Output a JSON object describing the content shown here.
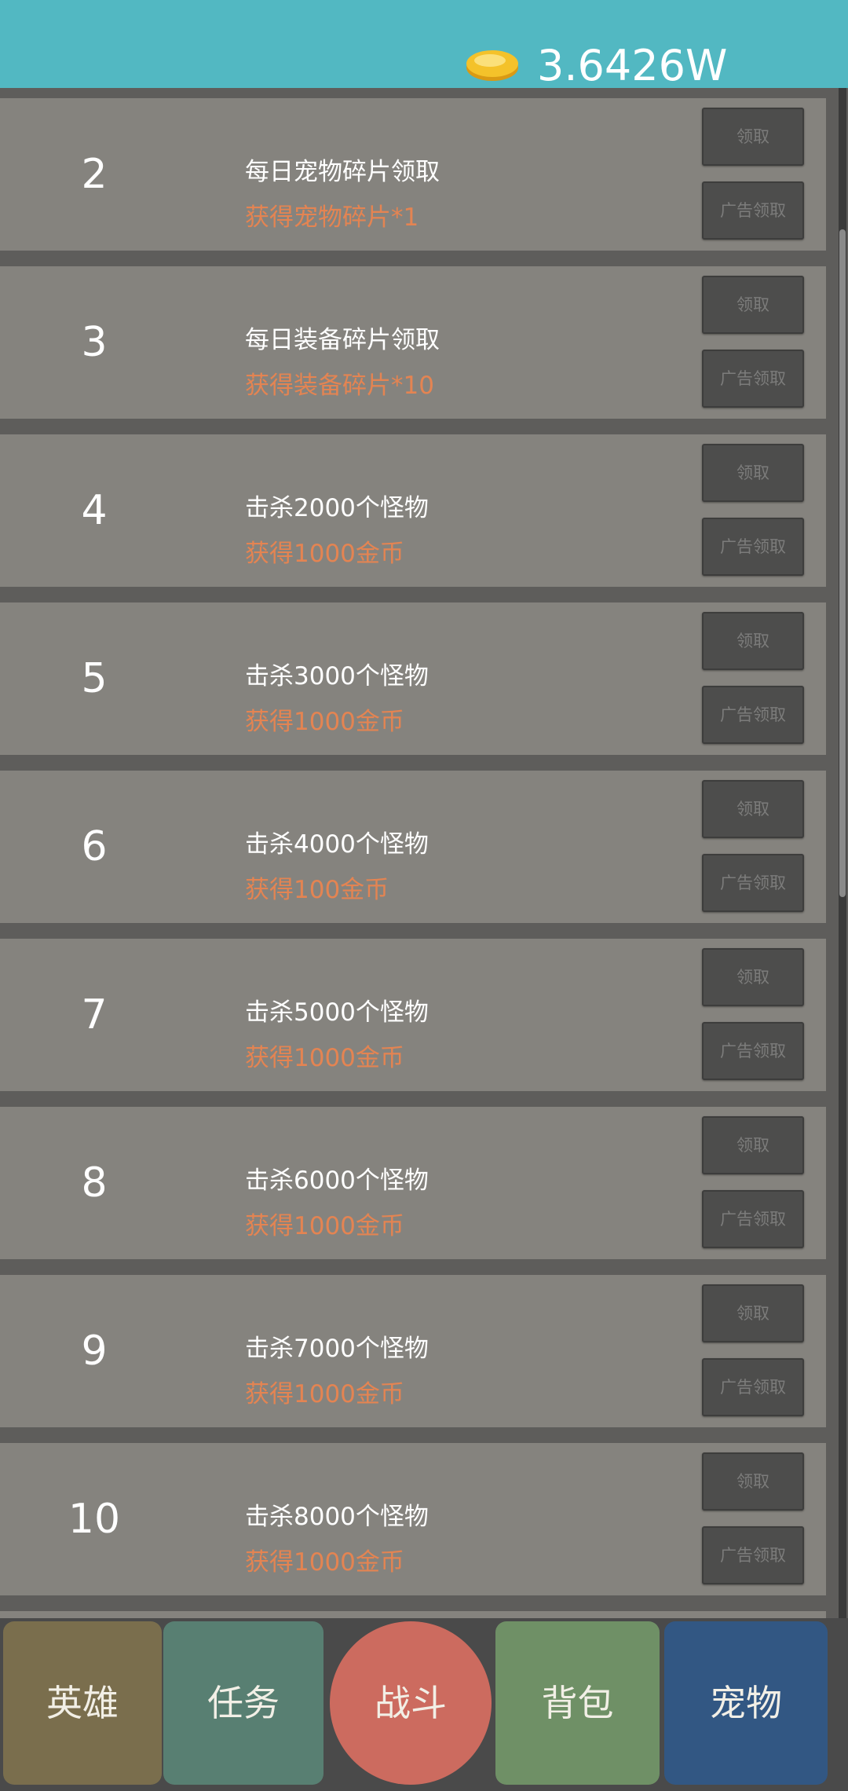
{
  "header": {
    "coin_icon": "gold-coin-icon",
    "coin_amount": "3.6426W"
  },
  "tasks": [
    {
      "num": "2",
      "title": "每日宠物碎片领取",
      "reward": "获得宠物碎片*1",
      "claim_label": "领取",
      "ad_label": "广告领取"
    },
    {
      "num": "3",
      "title": "每日装备碎片领取",
      "reward": "获得装备碎片*10",
      "claim_label": "领取",
      "ad_label": "广告领取"
    },
    {
      "num": "4",
      "title": "击杀2000个怪物",
      "reward": "获得1000金币",
      "claim_label": "领取",
      "ad_label": "广告领取"
    },
    {
      "num": "5",
      "title": "击杀3000个怪物",
      "reward": "获得1000金币",
      "claim_label": "领取",
      "ad_label": "广告领取"
    },
    {
      "num": "6",
      "title": "击杀4000个怪物",
      "reward": "获得100金币",
      "claim_label": "领取",
      "ad_label": "广告领取"
    },
    {
      "num": "7",
      "title": "击杀5000个怪物",
      "reward": "获得1000金币",
      "claim_label": "领取",
      "ad_label": "广告领取"
    },
    {
      "num": "8",
      "title": "击杀6000个怪物",
      "reward": "获得1000金币",
      "claim_label": "领取",
      "ad_label": "广告领取"
    },
    {
      "num": "9",
      "title": "击杀7000个怪物",
      "reward": "获得1000金币",
      "claim_label": "领取",
      "ad_label": "广告领取"
    },
    {
      "num": "10",
      "title": "击杀8000个怪物",
      "reward": "获得1000金币",
      "claim_label": "领取",
      "ad_label": "广告领取"
    }
  ],
  "nav": {
    "hero": "英雄",
    "task": "任务",
    "battle": "战斗",
    "bag": "背包",
    "pet": "宠物"
  },
  "colors": {
    "header_bg": "#52b8c2",
    "row_bg": "#85837e",
    "reward_text": "#e48452",
    "button_bg": "#4d4d4c"
  }
}
